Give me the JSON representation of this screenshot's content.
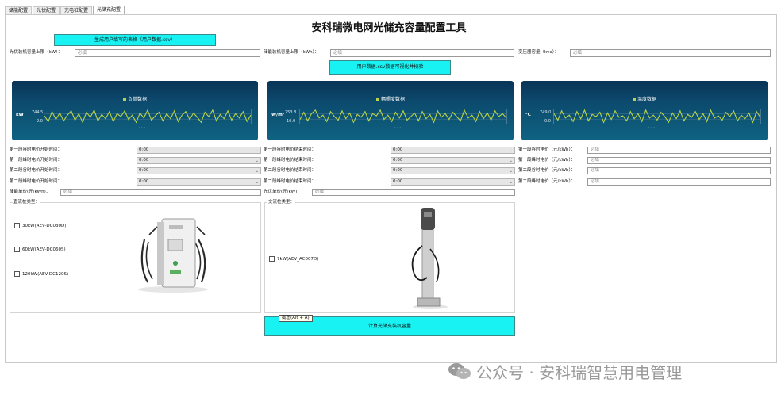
{
  "tabs": [
    "储能配置",
    "光伏配置",
    "充电桩配置",
    "光储充配置"
  ],
  "active_tab": 3,
  "title": "安科瑞微电网光储充容量配置工具",
  "buttons": {
    "generate_template": "生成用户填写的表格（用户数据.csv）",
    "visualize": "用户数据.csv数据可视化并校验",
    "calculate": "计算光储充装机容量"
  },
  "top_fields": {
    "pv_upper": {
      "label": "光伏装机容量上限（kW）：",
      "placeholder": "必填"
    },
    "storage_upper": {
      "label": "储能装机容量上限（kWh）：",
      "placeholder": "必填"
    },
    "transformer": {
      "label": "变压器容量（kva）：",
      "placeholder": "必填"
    }
  },
  "charts": [
    {
      "legend": "负荷数据",
      "ylabel": "kW",
      "ytop": "744.5",
      "ybottom": "2.0",
      "xticks": "· · ·",
      "color": "#b9d44a",
      "values": [
        0.55,
        0.15,
        0.85,
        0.3,
        0.75,
        0.2,
        0.6,
        0.9,
        0.25,
        0.7,
        0.1,
        0.8,
        0.45,
        0.95,
        0.2,
        0.65,
        0.35,
        0.85,
        0.15,
        0.7,
        0.5,
        0.9,
        0.3,
        0.6,
        0.1,
        0.75,
        0.4,
        0.95,
        0.25,
        0.55,
        0.8,
        0.2,
        0.7,
        0.35,
        0.9,
        0.15,
        0.6,
        0.85,
        0.3,
        0.75,
        0.45,
        0.1,
        0.8,
        0.5,
        0.95,
        0.2,
        0.65,
        0.35,
        0.9,
        0.25,
        0.7,
        0.4,
        0.85,
        0.15,
        0.6
      ]
    },
    {
      "legend": "辐照度数据",
      "ylabel": "W/m²",
      "ytop": "753.8",
      "ybottom": "10.0",
      "xticks": "· · ·",
      "color": "#b9d44a",
      "values": [
        0.3,
        0.8,
        0.2,
        0.7,
        0.95,
        0.4,
        0.6,
        0.15,
        0.85,
        0.5,
        0.25,
        0.9,
        0.35,
        0.75,
        0.1,
        0.65,
        0.45,
        0.85,
        0.2,
        0.7,
        0.55,
        0.95,
        0.3,
        0.6,
        0.15,
        0.8,
        0.4,
        0.9,
        0.25,
        0.5,
        0.75,
        0.2,
        0.85,
        0.35,
        0.65,
        0.1,
        0.9,
        0.45,
        0.7,
        0.3,
        0.8,
        0.5,
        0.2,
        0.95,
        0.4,
        0.6,
        0.15,
        0.85,
        0.35,
        0.75,
        0.25,
        0.9,
        0.5,
        0.7,
        0.4
      ]
    },
    {
      "legend": "温度数据",
      "ylabel": "°C",
      "ytop": "749.0",
      "ybottom": "0.0",
      "xticks": "· · ·",
      "color": "#b9d44a",
      "values": [
        0.7,
        0.25,
        0.9,
        0.4,
        0.6,
        0.15,
        0.85,
        0.35,
        0.95,
        0.2,
        0.65,
        0.5,
        0.8,
        0.1,
        0.75,
        0.3,
        0.9,
        0.45,
        0.55,
        0.2,
        0.85,
        0.35,
        0.7,
        0.15,
        0.95,
        0.4,
        0.6,
        0.25,
        0.8,
        0.5,
        0.1,
        0.75,
        0.35,
        0.9,
        0.2,
        0.65,
        0.45,
        0.85,
        0.3,
        0.7,
        0.15,
        0.95,
        0.4,
        0.55,
        0.25,
        0.8,
        0.5,
        0.9,
        0.2,
        0.6,
        0.35,
        0.75,
        0.1,
        0.85,
        0.45
      ]
    }
  ],
  "time_rows": {
    "col1": [
      {
        "label": "第一段谷时电价开始时间：",
        "value": "0:00"
      },
      {
        "label": "第一段峰时电价开始时间：",
        "value": "0:00"
      },
      {
        "label": "第二段谷时电价开始时间：",
        "value": "0:00"
      },
      {
        "label": "第二段峰时电价开始时间：",
        "value": "0:00"
      }
    ],
    "col2": [
      {
        "label": "第一段谷时电价结束时间：",
        "value": "0:00"
      },
      {
        "label": "第一段峰时电价结束时间：",
        "value": "0:00"
      },
      {
        "label": "第二段谷时电价结束时间：",
        "value": "0:00"
      },
      {
        "label": "第二段峰时电价结束时间：",
        "value": "0:00"
      }
    ],
    "col3": [
      {
        "label": "第一段谷时电价（元/kWh）：",
        "placeholder": "必填"
      },
      {
        "label": "第一段峰时电价（元/kWh）：",
        "placeholder": "必填"
      },
      {
        "label": "第二段谷时电价（元/kWh）：",
        "placeholder": "必填"
      },
      {
        "label": "第二段峰时电价（元/kWh）：",
        "placeholder": "必填"
      }
    ]
  },
  "unit_prices": {
    "storage": {
      "label": "储能单价(元/kWh)：",
      "placeholder": "必填"
    },
    "pv": {
      "label": "光伏单价(元/kW)：",
      "placeholder": "必填"
    }
  },
  "dc_group": {
    "title": "直流桩类型：",
    "options": [
      "30kW(AEV-DC030D)",
      "60kW(AEV-DC060S)",
      "120kW(AEV-DC120S)"
    ]
  },
  "ac_group": {
    "title": "交流桩类型：",
    "options": [
      "7kW(AEV_AC007D)"
    ]
  },
  "tooltip": "截图(Alt + A)",
  "watermark": "公众号 · 安科瑞智慧用电管理",
  "colors": {
    "accent_button": "#18f2f2",
    "chart_bg": "#0c4a6e",
    "series": "#b9d44a"
  }
}
